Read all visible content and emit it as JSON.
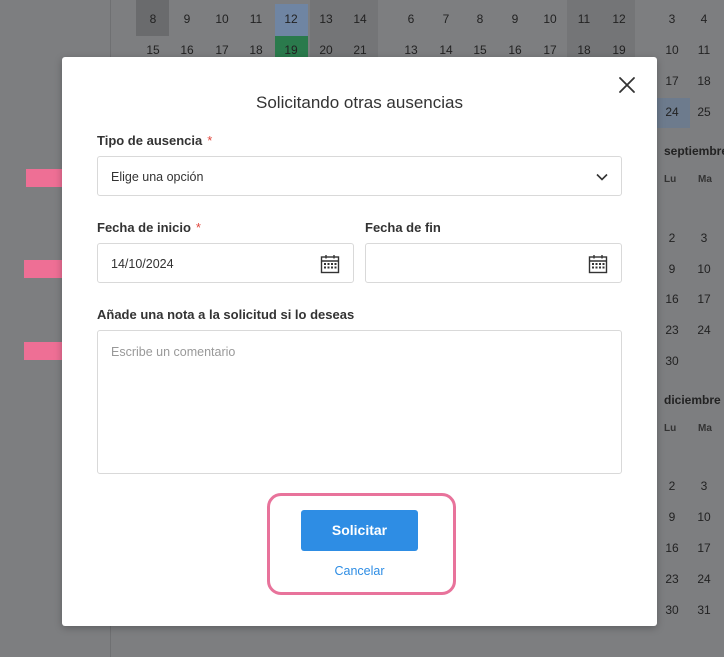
{
  "background_calendar": {
    "rows_left": [
      [
        "8",
        "9",
        "10",
        "11",
        "12",
        "13",
        "14"
      ],
      [
        "15",
        "16",
        "17",
        "18",
        "19",
        "20",
        "21"
      ]
    ],
    "rows_mid": [
      [
        "6",
        "7",
        "8",
        "9",
        "10",
        "11",
        "12"
      ],
      [
        "13",
        "14",
        "15",
        "16",
        "17",
        "18",
        "19"
      ]
    ],
    "right_col_top": [
      [
        "3",
        "4"
      ],
      [
        "10",
        "11"
      ],
      [
        "17",
        "18"
      ],
      [
        "24",
        "25"
      ]
    ],
    "month_september": "septiembre",
    "month_december": "diciembre",
    "dow": [
      "Lu",
      "Ma"
    ],
    "september_days": [
      [
        "2",
        "3"
      ],
      [
        "9",
        "10"
      ],
      [
        "16",
        "17"
      ],
      [
        "23",
        "24"
      ],
      [
        "30",
        ""
      ]
    ],
    "december_days": [
      [
        "2",
        "3"
      ],
      [
        "9",
        "10"
      ],
      [
        "16",
        "17"
      ],
      [
        "23",
        "24"
      ],
      [
        "30",
        "31"
      ]
    ]
  },
  "modal": {
    "title": "Solicitando otras ausencias",
    "absence_type": {
      "label": "Tipo de ausencia",
      "required_mark": "*",
      "placeholder": "Elige una opción"
    },
    "start_date": {
      "label": "Fecha de inicio",
      "required_mark": "*",
      "value": "14/10/2024"
    },
    "end_date": {
      "label": "Fecha de fin",
      "value": ""
    },
    "note": {
      "label": "Añade una nota a la solicitud si lo deseas",
      "placeholder": "Escribe un comentario"
    },
    "submit_label": "Solicitar",
    "cancel_label": "Cancelar"
  },
  "colors": {
    "primary": "#2e8de4",
    "highlight": "#e8739b",
    "required": "#e0463c",
    "today": "#2a9d5c",
    "selected": "#8aaed8"
  }
}
